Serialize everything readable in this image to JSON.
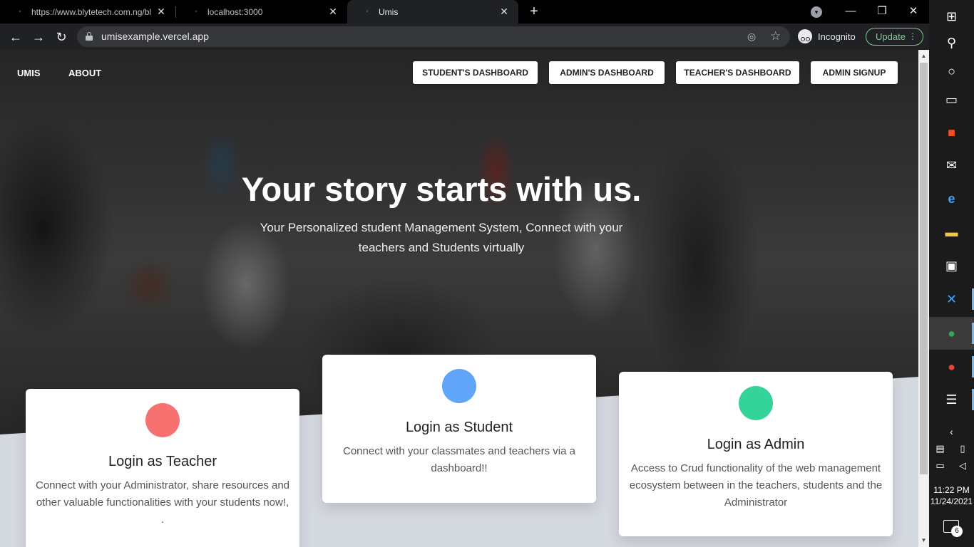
{
  "browser": {
    "tabs": [
      {
        "title": "https://www.blytetech.com.ng/bl",
        "active": false
      },
      {
        "title": "localhost:3000",
        "active": false
      },
      {
        "title": "Umis",
        "active": true
      }
    ],
    "new_tab": "+",
    "url": "umisexample.vercel.app",
    "incognito_label": "Incognito",
    "update_label": "Update"
  },
  "site": {
    "nav_left": [
      "UMIS",
      "ABOUT"
    ],
    "nav_buttons": [
      "STUDENT'S DASHBOARD",
      "ADMIN'S DASHBOARD",
      "TEACHER'S DASHBOARD",
      "ADMIN SIGNUP"
    ],
    "headline": "Your story starts with us.",
    "subline": "Your Personalized student Management System, Connect with your teachers and Students virtually",
    "cards": [
      {
        "title": "Login as Teacher",
        "desc": "Connect with your Administrator, share resources and other valuable functionalities with your students now!, .",
        "color": "#f87171"
      },
      {
        "title": "Login as Student",
        "desc": "Connect with your classmates and teachers via a dashboard!!",
        "color": "#60a5fa"
      },
      {
        "title": "Login as Admin",
        "desc": "Access to Crud functionality of the web management ecosystem between in the teachers, students and the Administrator",
        "color": "#34d399"
      }
    ]
  },
  "taskbar": {
    "time": "11:22 PM",
    "date": "11/24/2021",
    "notification_count": "6",
    "icons": [
      "windows-start-icon",
      "search-icon",
      "cortana-icon",
      "task-view-icon",
      "store-icon",
      "mail-icon",
      "edge-icon",
      "file-explorer-icon",
      "terminal-icon",
      "vscode-icon",
      "chrome-profile-a-icon",
      "chrome-profile-b-icon",
      "list-app-icon"
    ]
  }
}
